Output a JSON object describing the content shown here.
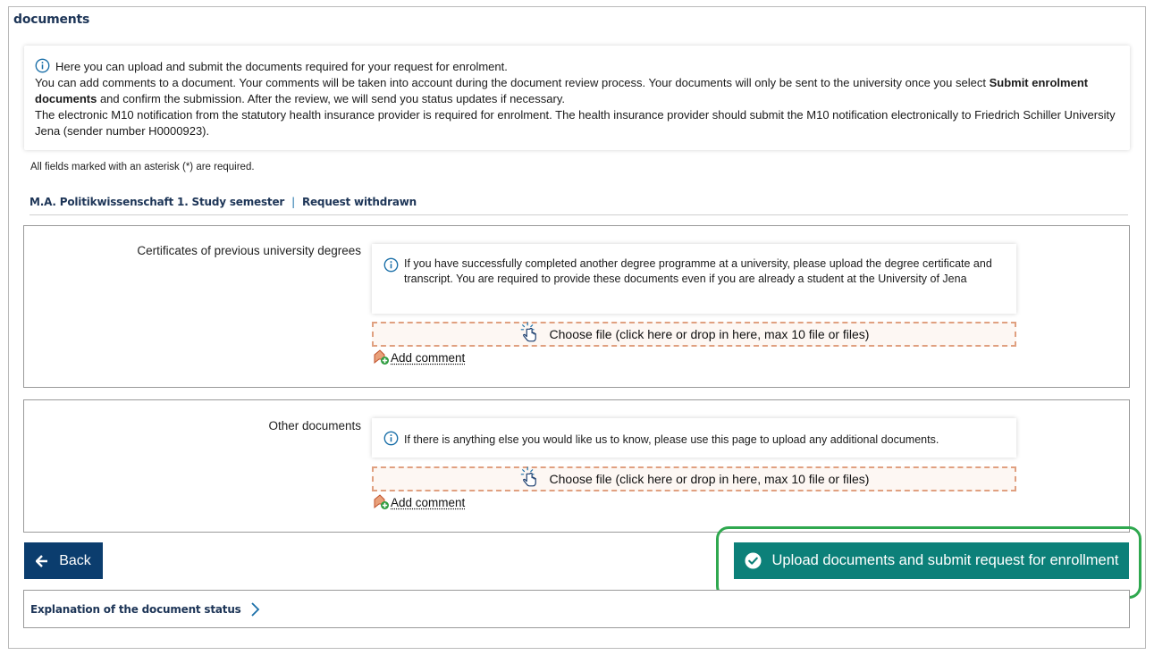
{
  "page": {
    "title": "documents"
  },
  "info": {
    "line1": "Here you can upload and submit the documents required for your request for enrolment.",
    "line2_start": "You can add comments to a document. Your comments will be taken into account during the document review process. Your documents will only be sent to the university once you select ",
    "line2_bold": "Submit enrolment documents",
    "line2_end": " and confirm the submission. After the review, we will send you status updates if necessary.",
    "line3": "The electronic M10 notification from the statutory health insurance provider is required for enrolment. The health insurance provider should submit the M10 notification electronically to Friedrich Schiller University Jena (sender number H0000923)."
  },
  "form": {
    "required_note": "All fields marked with an asterisk (*) are required."
  },
  "program": {
    "name": "M.A. Politikwissenschaft 1. Study semester",
    "separator": "|",
    "status": "Request withdrawn"
  },
  "sections": [
    {
      "label": "Certificates of previous university degrees",
      "info": "If you have successfully completed another degree programme at a university, please upload the degree certificate and transcript. You are required to provide these documents even if you are already a student at the University of Jena",
      "drop_label": "Choose file (click here or drop in here, max 10 file or files)",
      "comment_label": "Add comment"
    },
    {
      "label": "Other documents",
      "info": "If there is anything else you would like us to know, please use this page to upload any additional documents.",
      "drop_label": "Choose file (click here or drop in here, max 10 file or files)",
      "comment_label": "Add comment"
    }
  ],
  "actions": {
    "back_label": "Back",
    "submit_label": "Upload documents and submit request for enrollment"
  },
  "status_link": {
    "label": "Explanation of the document status"
  },
  "icons": {
    "info": "info-circle-icon",
    "drop": "pointer-hand-icon",
    "comment": "comment-add-icon",
    "back": "arrow-left-icon",
    "submit": "check-circle-icon",
    "chevron": "chevron-right-icon"
  },
  "colors": {
    "title": "#1d3557",
    "back_button": "#0b3d6e",
    "submit_button": "#0c8079",
    "highlight": "#2fa84f",
    "drop_border": "#e0a080",
    "info_icon": "#1a6fa8"
  }
}
